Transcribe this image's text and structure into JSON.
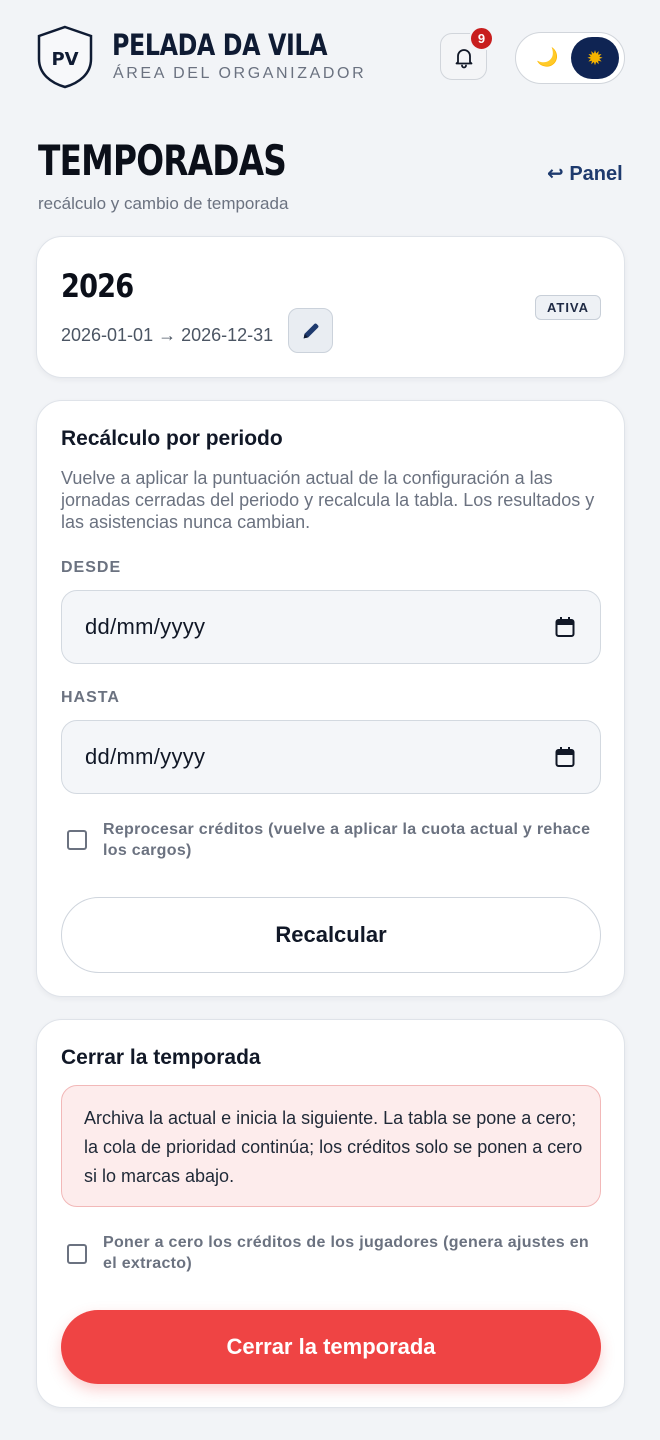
{
  "header": {
    "logo_initials": "PV",
    "title": "PELADA DA VILA",
    "subtitle": "ÁREA DEL ORGANIZADOR",
    "notifications_count": "9",
    "theme_moon": "🌙",
    "theme_sun": "✹"
  },
  "page": {
    "title": "TEMPORADAS",
    "subtitle": "recálculo y cambio de temporada",
    "back_link": "↩ Panel"
  },
  "season": {
    "year": "2026",
    "range": "2026-01-01 → 2026-12-31",
    "status": "ATIVA"
  },
  "recalc": {
    "heading": "Recálculo por periodo",
    "description": "Vuelve a aplicar la puntuación actual de la configuración a las jornadas cerradas del periodo y recalcula la tabla. Los resultados y las asistencias nunca cambian.",
    "from_label": "DESDE",
    "from_placeholder": "dd/mm/yyyy",
    "to_label": "HASTA",
    "to_placeholder": "dd/mm/yyyy",
    "reprocess_label": "Reprocesar créditos (vuelve a aplicar la cuota actual y rehace los cargos)",
    "reprocess_checked": false,
    "button": "Recalcular"
  },
  "close_season": {
    "heading": "Cerrar la temporada",
    "warning": "Archiva la actual e inicia la siguiente. La tabla se pone a cero; la cola de prioridad continúa; los créditos solo se ponen a cero si lo marcas abajo.",
    "reset_credits_label": "Poner a cero los créditos de los jugadores (genera ajustes en el extracto)",
    "reset_credits_checked": false,
    "button": "Cerrar la temporada"
  },
  "colors": {
    "brand_navy": "#0f2453",
    "danger": "#ef4444",
    "badge_red": "#c81e1e",
    "background": "#f2f4f7"
  }
}
